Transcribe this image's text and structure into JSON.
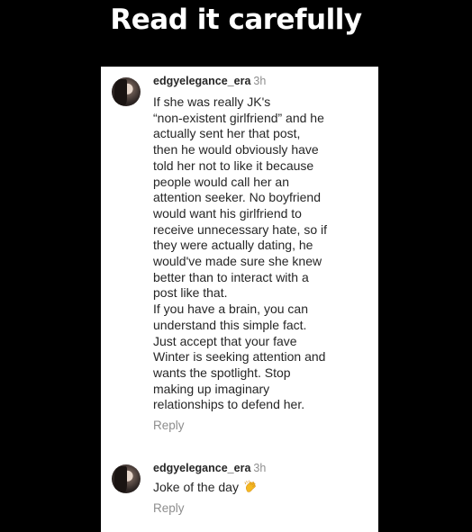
{
  "headline": "Read it carefully",
  "comments": [
    {
      "username": "edgyelegance_era",
      "time": "3h",
      "lines": [
        "If she was really JK's",
        "“non-existent girlfriend” and he",
        "actually sent her that post,",
        "then he would obviously have",
        "told her not to like it because",
        "people would call her an",
        "attention seeker. No boyfriend",
        "would want his girlfriend to",
        "receive unnecessary hate, so if",
        "they were actually dating, he",
        "would've made sure she knew",
        "better than to interact with a",
        "post like that.",
        "If you have a brain, you can",
        "understand this simple fact.",
        "Just accept that your fave",
        "Winter is seeking attention and",
        "wants the spotlight. Stop",
        "making up imaginary",
        "relationships to defend her."
      ],
      "reply_label": "Reply"
    },
    {
      "username": "edgyelegance_era",
      "time": "3h",
      "text": "Joke of the day",
      "emoji": "clapping-hands",
      "reply_label": "Reply"
    }
  ],
  "colors": {
    "background": "#000000",
    "card": "#ffffff",
    "text": "#262626",
    "muted": "#8e8e8e",
    "emoji": "#f5b921"
  }
}
